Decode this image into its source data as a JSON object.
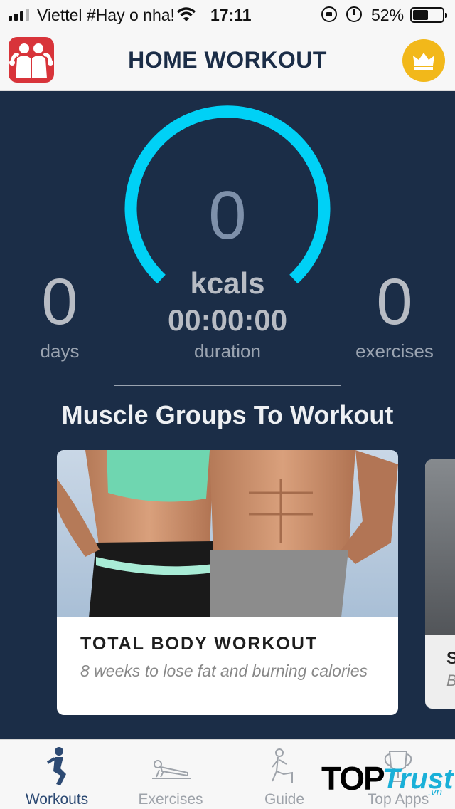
{
  "status_bar": {
    "carrier": "Viettel #Hay o nha!",
    "time": "17:11",
    "battery_percent": "52%",
    "battery_level": 0.52,
    "signal_bars": 3,
    "icons": [
      "signal-icon",
      "wifi-icon",
      "rotation-lock-icon",
      "alarm-icon",
      "battery-icon"
    ]
  },
  "header": {
    "title": "HOME WORKOUT",
    "logo_icon": "app-logo-icon",
    "premium_icon": "crown-icon"
  },
  "stats": {
    "kcals_value": "0",
    "kcals_label": "kcals",
    "kcal_progress": 0,
    "duration_value": "00:00:00",
    "duration_label": "duration",
    "days_value": "0",
    "days_label": "days",
    "exercises_value": "0",
    "exercises_label": "exercises"
  },
  "section": {
    "title": "Muscle Groups To Workout"
  },
  "cards": [
    {
      "title": "TOTAL BODY WORKOUT",
      "description": "8 weeks to lose fat and burning calories"
    },
    {
      "title_peek": "S",
      "description_peek": "B"
    }
  ],
  "tabs": [
    {
      "label": "Workouts",
      "icon": "squat-icon",
      "active": true
    },
    {
      "label": "Exercises",
      "icon": "pushup-icon",
      "active": false
    },
    {
      "label": "Guide",
      "icon": "stretch-icon",
      "active": false
    },
    {
      "label": "Top Apps",
      "icon": "trophy-icon",
      "active": false
    }
  ],
  "watermark": {
    "top": "TOP",
    "trust": "Trust",
    "vn": ".vn"
  },
  "colors": {
    "background": "#1b2d47",
    "gauge": "#00d1f6",
    "premium": "#f2b81a",
    "logo": "#d8343a",
    "active_tab": "#2d4a73"
  }
}
